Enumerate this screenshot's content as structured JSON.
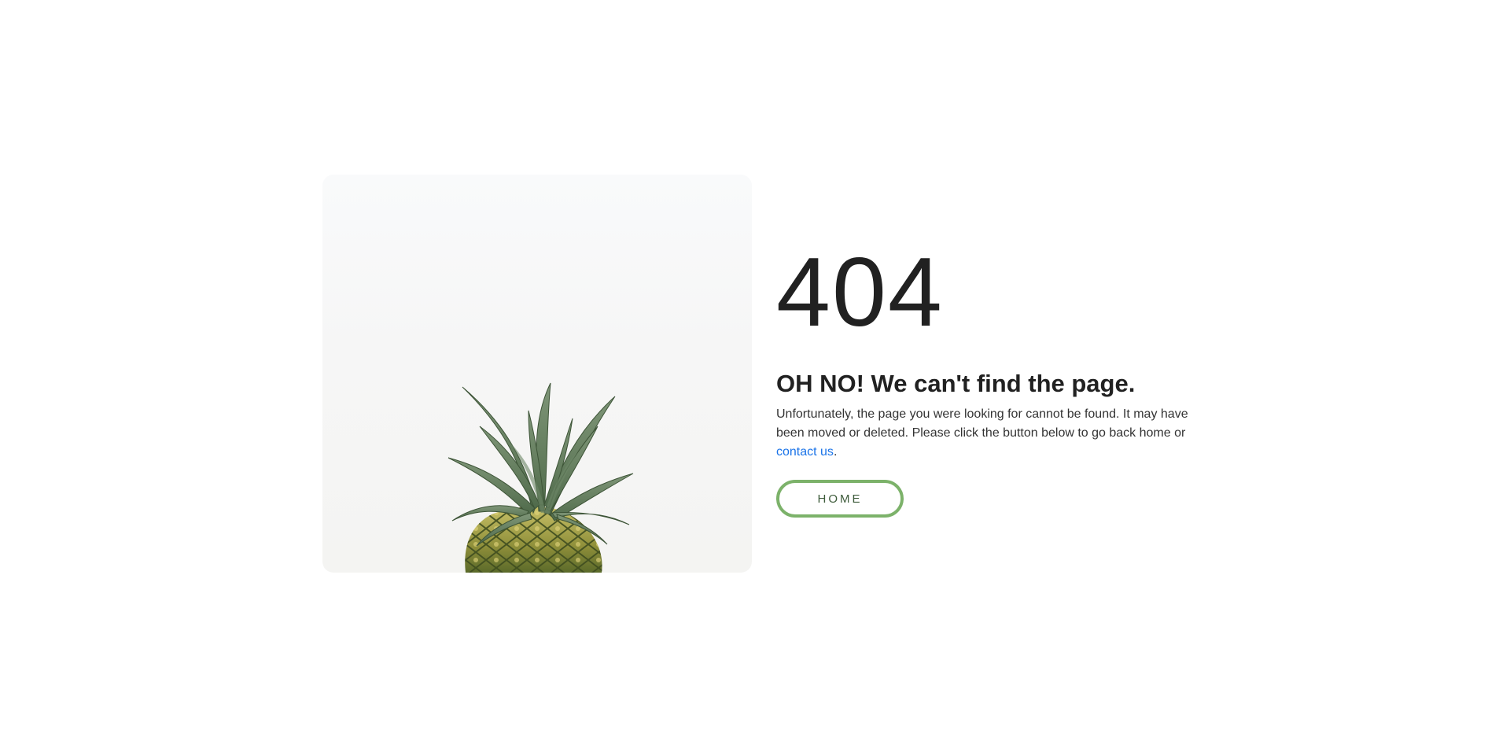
{
  "error": {
    "code": "404",
    "headline": "OH NO! We can't find the page.",
    "message_before_link": "Unfortunately, the page you were looking for cannot be found. It may have been moved or deleted. Please click the button below to go back home or ",
    "link_text": "contact us",
    "message_after_link": "."
  },
  "actions": {
    "home_label": "HOME"
  },
  "image": {
    "subject": "pineapple-illustration"
  },
  "colors": {
    "text": "#212121",
    "link": "#1a73e8",
    "button_border": "#7cb26a",
    "button_text": "#3d5b3a"
  }
}
